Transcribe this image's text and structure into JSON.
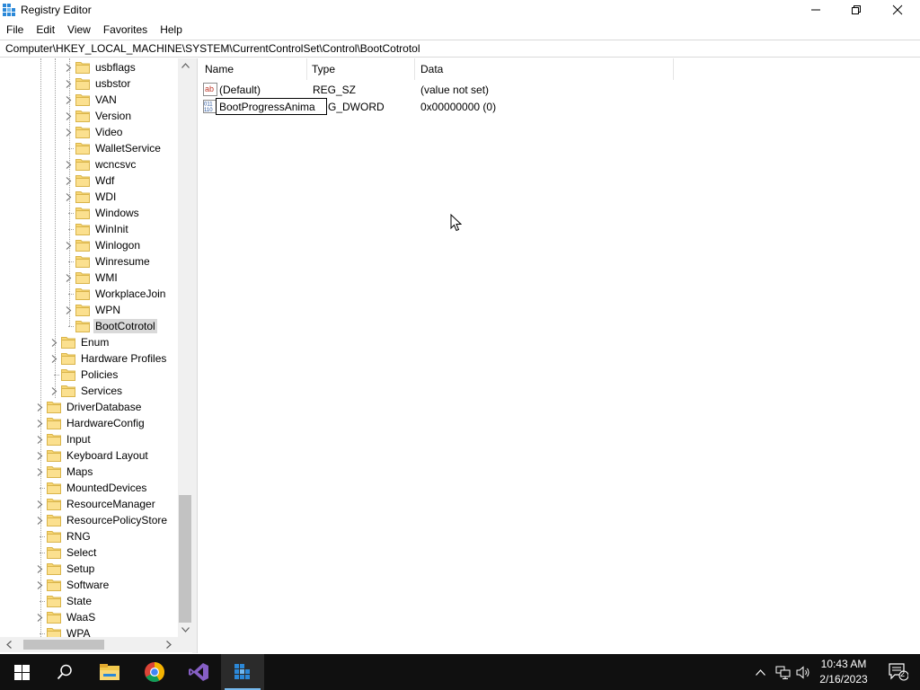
{
  "window": {
    "title": "Registry Editor",
    "minimize_icon": "minimize-icon",
    "maximize_icon": "restore-icon",
    "close_icon": "close-icon"
  },
  "menu": [
    "File",
    "Edit",
    "View",
    "Favorites",
    "Help"
  ],
  "address": "Computer\\HKEY_LOCAL_MACHINE\\SYSTEM\\CurrentControlSet\\Control\\BootCotrotol",
  "tree": {
    "control_children": [
      "usbflags",
      "usbstor",
      "VAN",
      "Version",
      "Video",
      "WalletService",
      "wcncsvc",
      "Wdf",
      "WDI",
      "Windows",
      "WinInit",
      "Winlogon",
      "Winresume",
      "WMI",
      "WorkplaceJoin",
      "WPN",
      "BootCotrotol"
    ],
    "selected": "BootCotrotol",
    "currentcontrolset_children": [
      "Enum",
      "Hardware Profiles",
      "Policies",
      "Services"
    ],
    "control_children_2": [
      "DriverDatabase",
      "HardwareConfig",
      "Input",
      "Keyboard Layout",
      "Maps",
      "MountedDevices",
      "ResourceManager",
      "ResourcePolicyStore",
      "RNG",
      "Select",
      "Setup",
      "Software",
      "State",
      "WaaS",
      "WPA"
    ]
  },
  "list": {
    "columns": [
      "Name",
      "Type",
      "Data"
    ],
    "values": [
      {
        "name": "(Default)",
        "type": "REG_SZ",
        "data": "(value not set)",
        "icon": "string-value-icon"
      },
      {
        "name": "BootProgressAnima",
        "type": "REG_DWORD",
        "type_visible": "G_DWORD",
        "data": "0x00000000 (0)",
        "icon": "binary-value-icon",
        "editing": true
      }
    ]
  },
  "taskbar": {
    "apps": [
      "start-icon",
      "search-icon",
      "file-explorer-icon",
      "chrome-icon",
      "visual-studio-icon",
      "registry-editor-icon"
    ],
    "time": "10:43 AM",
    "date": "2/16/2023",
    "notifications_count": "2"
  },
  "colors": {
    "taskbar_bg": "#101010",
    "selected_bg": "#d9d9d9",
    "folder": "#f8d775",
    "active_indicator": "#76b9ed"
  }
}
